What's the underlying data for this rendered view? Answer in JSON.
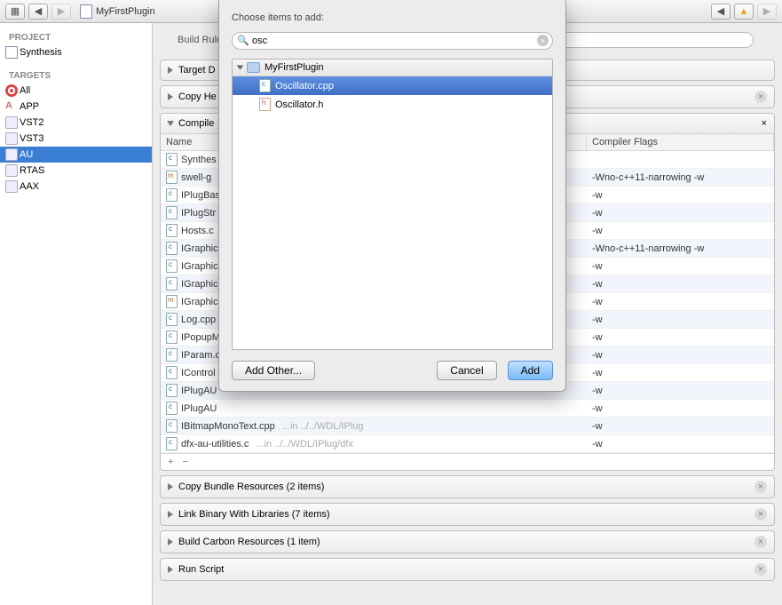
{
  "toolbar": {
    "breadcrumb": "MyFirstPlugin"
  },
  "sidebar": {
    "projectHead": "PROJECT",
    "project": "Synthesis",
    "targetsHead": "TARGETS",
    "targets": [
      "All",
      "APP",
      "VST2",
      "VST3",
      "AU",
      "RTAS",
      "AAX"
    ],
    "selectedIndex": 4
  },
  "tabs": {
    "buildRules": "Build Rules"
  },
  "sections": {
    "targetDeps": "Target D",
    "copyHeaders": "Copy He",
    "compileSources": "Compile",
    "copyBundle": "Copy Bundle Resources (2 items)",
    "linkBinary": "Link Binary With Libraries (7 items)",
    "buildCarbon": "Build Carbon Resources (1 item)",
    "runScript": "Run Script"
  },
  "table": {
    "nameHead": "Name",
    "flagsHead": "Compiler Flags",
    "rows": [
      {
        "icon": "c",
        "name": "Synthes",
        "flags": ""
      },
      {
        "icon": "m",
        "name": "swell-g",
        "flags": "-Wno-c++11-narrowing -w"
      },
      {
        "icon": "c",
        "name": "IPlugBas",
        "flags": "-w"
      },
      {
        "icon": "c",
        "name": "IPlugStr",
        "flags": "-w"
      },
      {
        "icon": "c",
        "name": "Hosts.c",
        "flags": "-w"
      },
      {
        "icon": "c",
        "name": "IGraphic",
        "flags": "-Wno-c++11-narrowing -w"
      },
      {
        "icon": "c",
        "name": "IGraphic",
        "flags": "-w"
      },
      {
        "icon": "c",
        "name": "IGraphic",
        "flags": "-w"
      },
      {
        "icon": "m",
        "name": "IGraphic",
        "flags": "-w"
      },
      {
        "icon": "c",
        "name": "Log.cpp",
        "flags": "-w"
      },
      {
        "icon": "c",
        "name": "IPopupM",
        "flags": "-w"
      },
      {
        "icon": "c",
        "name": "IParam.c",
        "flags": "-w"
      },
      {
        "icon": "c",
        "name": "IControl",
        "flags": "-w"
      },
      {
        "icon": "c",
        "name": "IPlugAU",
        "flags": "-w"
      },
      {
        "icon": "c",
        "name": "IPlugAU",
        "flags": "-w"
      },
      {
        "icon": "c",
        "name": "IBitmapMonoText.cpp",
        "path": "...in ../../WDL/IPlug",
        "flags": "-w"
      },
      {
        "icon": "c",
        "name": "dfx-au-utilities.c",
        "path": "...in ../../WDL/IPlug/dfx",
        "flags": "-w"
      }
    ]
  },
  "modal": {
    "title": "Choose items to add:",
    "search": "osc",
    "project": "MyFirstPlugin",
    "items": [
      {
        "icon": "c",
        "name": "Oscillator.cpp",
        "sel": true
      },
      {
        "icon": "h",
        "name": "Oscillator.h",
        "sel": false
      }
    ],
    "addOther": "Add Other...",
    "cancel": "Cancel",
    "add": "Add"
  }
}
